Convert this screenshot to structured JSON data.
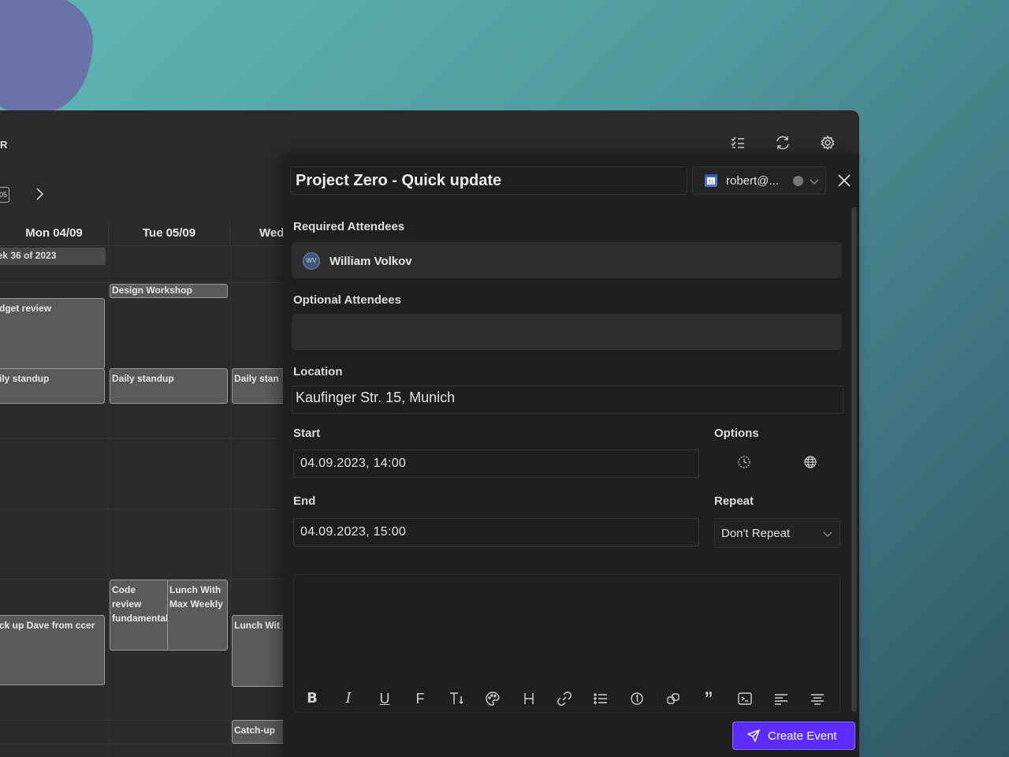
{
  "app": {
    "title": "R",
    "week_nav_label": "05"
  },
  "calendar": {
    "days": [
      "Mon 04/09",
      "Tue 05/09",
      "Wed"
    ],
    "week_badge": "eek 36 of 2023",
    "events": {
      "design_workshop": "Design Workshop",
      "budget_review": "dget review",
      "daily_standup_mon": "ily standup",
      "daily_standup_tue": "Daily standup",
      "daily_standup_wed": "Daily stan",
      "code_review": "Code review fundamental",
      "lunch_max": "Lunch With Max Weekly",
      "lunch_wed": "Lunch Wit",
      "pickup_dave": "ck up Dave from ccer",
      "catch_up": "Catch-up"
    }
  },
  "dialog": {
    "title": "Project Zero - Quick update",
    "account_email": "robert@...",
    "required_label": "Required Attendees",
    "required_attendees": [
      {
        "initials": "WV",
        "name": "William Volkov"
      }
    ],
    "optional_label": "Optional Attendees",
    "location_label": "Location",
    "location_value": "Kaufinger Str. 15, Munich",
    "start_label": "Start",
    "start_value": "04.09.2023, 14:00",
    "end_label": "End",
    "end_value": "04.09.2023, 15:00",
    "options_label": "Options",
    "repeat_label": "Repeat",
    "repeat_value": "Don't Repeat",
    "create_label": "Create Event"
  },
  "colors": {
    "accent": "#5b2bff",
    "panel": "#1f1f1f",
    "field": "#2e2e2e"
  }
}
